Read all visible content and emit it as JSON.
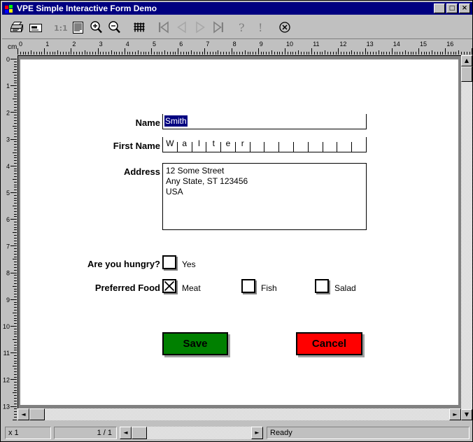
{
  "window": {
    "title": "VPE Simple Interactive Form Demo",
    "icon": "vpe-logo-icon",
    "minimize_label": "_",
    "maximize_label": "□",
    "close_label": "×"
  },
  "toolbar": {
    "items": [
      {
        "name": "print-icon",
        "tooltip": "Print"
      },
      {
        "name": "print-preview-icon",
        "tooltip": "Print Preview"
      },
      {
        "name": "zoom-100-icon",
        "tooltip": "Zoom 1:1"
      },
      {
        "name": "fit-page-icon",
        "tooltip": "Fit Page"
      },
      {
        "name": "zoom-in-icon",
        "tooltip": "Zoom In"
      },
      {
        "name": "zoom-out-icon",
        "tooltip": "Zoom Out"
      },
      {
        "name": "grid-icon",
        "tooltip": "Grid"
      },
      {
        "name": "first-page-icon",
        "tooltip": "First Page"
      },
      {
        "name": "previous-page-icon",
        "tooltip": "Previous Page"
      },
      {
        "name": "next-page-icon",
        "tooltip": "Next Page"
      },
      {
        "name": "last-page-icon",
        "tooltip": "Last Page"
      },
      {
        "name": "help-icon",
        "tooltip": "Help"
      },
      {
        "name": "info-icon",
        "tooltip": "Info"
      },
      {
        "name": "close-icon",
        "tooltip": "Close"
      }
    ]
  },
  "rulers": {
    "unit_label": "cm",
    "horizontal_ticks": [
      0,
      1,
      2,
      3,
      4,
      5,
      6,
      7,
      8,
      9,
      10,
      11,
      12,
      13,
      14,
      15,
      16
    ],
    "vertical_ticks": [
      0,
      1,
      2,
      3,
      4,
      5,
      6,
      7,
      8,
      9,
      10,
      11,
      12,
      13
    ]
  },
  "form": {
    "fields": [
      {
        "label": "Name",
        "value": "Smith",
        "selected": true
      },
      {
        "label": "First Name",
        "value": "Walter",
        "cells": 14
      },
      {
        "label": "Address",
        "value": "12 Some Street\nAny State, ST 123456\nUSA"
      }
    ],
    "hungry": {
      "label": "Are you hungry?",
      "option_label": "Yes",
      "checked": false
    },
    "preferred_food": {
      "label": "Preferred Food",
      "options": [
        {
          "label": "Meat",
          "checked": true
        },
        {
          "label": "Fish",
          "checked": false
        },
        {
          "label": "Salad",
          "checked": false
        }
      ]
    },
    "buttons": [
      {
        "label": "Save",
        "color": "#008000"
      },
      {
        "label": "Cancel",
        "color": "#ff0000"
      }
    ]
  },
  "statusbar": {
    "zoom": "x 1",
    "page": "1 / 1",
    "message": "Ready"
  },
  "scrollbars": {
    "up_arrow": "▲",
    "down_arrow": "▼",
    "left_arrow": "◄",
    "right_arrow": "►"
  },
  "colors": {
    "titlebar": "#000080",
    "face": "#c0c0c0",
    "selection": "#000080",
    "save": "#008000",
    "cancel": "#ff0000"
  }
}
